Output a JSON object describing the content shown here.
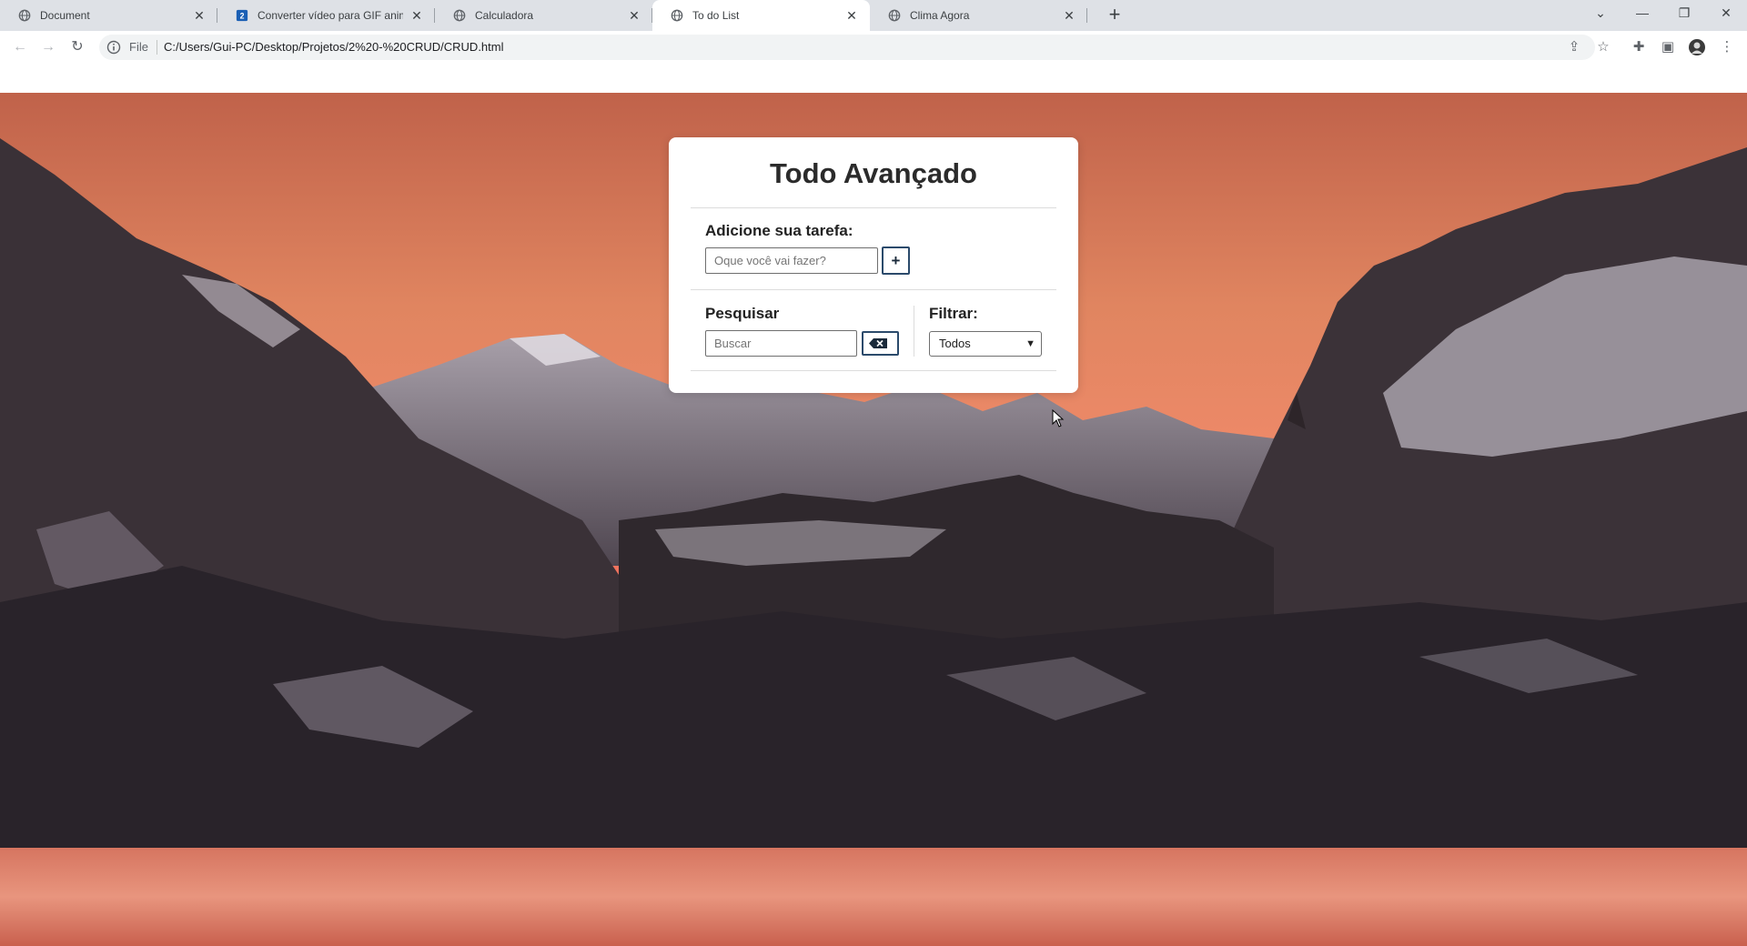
{
  "browser": {
    "tabs": [
      {
        "title": "Document",
        "favicon": "globe-icon",
        "active": false
      },
      {
        "title": "Converter vídeo para GIF animado",
        "favicon": "ezgif-icon",
        "active": false
      },
      {
        "title": "Calculadora",
        "favicon": "globe-icon",
        "active": false
      },
      {
        "title": "To do List",
        "favicon": "globe-icon",
        "active": true
      },
      {
        "title": "Clima Agora",
        "favicon": "globe-icon",
        "active": false
      }
    ],
    "address": {
      "scheme_label": "File",
      "url": "C:/Users/Gui-PC/Desktop/Projetos/2%20-%20CRUD/CRUD.html"
    }
  },
  "app": {
    "title": "Todo Avançado",
    "add": {
      "label": "Adicione sua tarefa:",
      "placeholder": "Oque você vai fazer?",
      "button_label": "+"
    },
    "search": {
      "label": "Pesquisar",
      "placeholder": "Buscar",
      "clear_icon": "backspace-icon"
    },
    "filter": {
      "label": "Filtrar:",
      "selected": "Todos"
    }
  }
}
